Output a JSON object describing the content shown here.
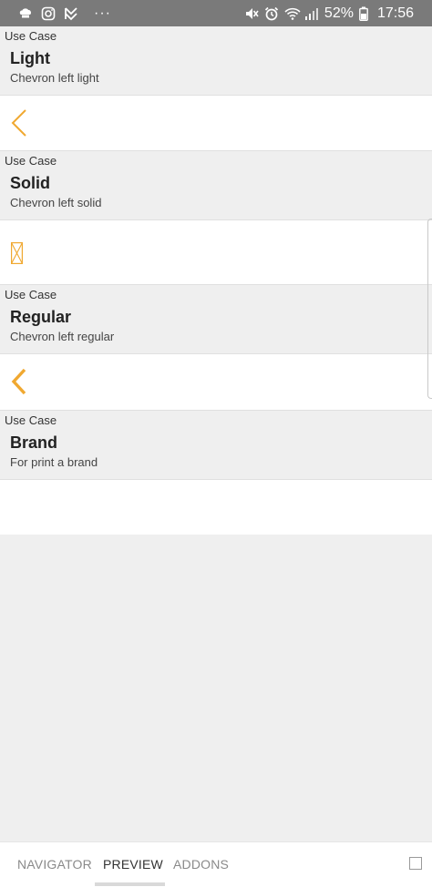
{
  "status_bar": {
    "battery": "52%",
    "time": "17:56",
    "icons_left": [
      "chef-hat-icon",
      "instagram-icon",
      "bookmark-v-icon"
    ],
    "overflow": "···",
    "icons_right": [
      "mute-icon",
      "alarm-icon",
      "wifi-icon",
      "signal-icon",
      "battery-icon"
    ]
  },
  "items": [
    {
      "label": "Use Case",
      "title": "Light",
      "description": "Chevron left light",
      "icon": "chevron-left-light-icon"
    },
    {
      "label": "Use Case",
      "title": "Solid",
      "description": "Chevron left solid",
      "icon": "missing-glyph-icon"
    },
    {
      "label": "Use Case",
      "title": "Regular",
      "description": "Chevron left regular",
      "icon": "chevron-left-regular-icon"
    },
    {
      "label": "Use Case",
      "title": "Brand",
      "description": "For print a brand",
      "icon": ""
    }
  ],
  "tabs": [
    {
      "label": "NAVIGATOR",
      "active": false
    },
    {
      "label": "PREVIEW",
      "active": true
    },
    {
      "label": "ADDONS",
      "active": false
    }
  ],
  "colors": {
    "accent": "#f0a830",
    "status_bar": "#7a7a7a",
    "section_bg": "#efefef",
    "row_bg": "#ffffff"
  }
}
